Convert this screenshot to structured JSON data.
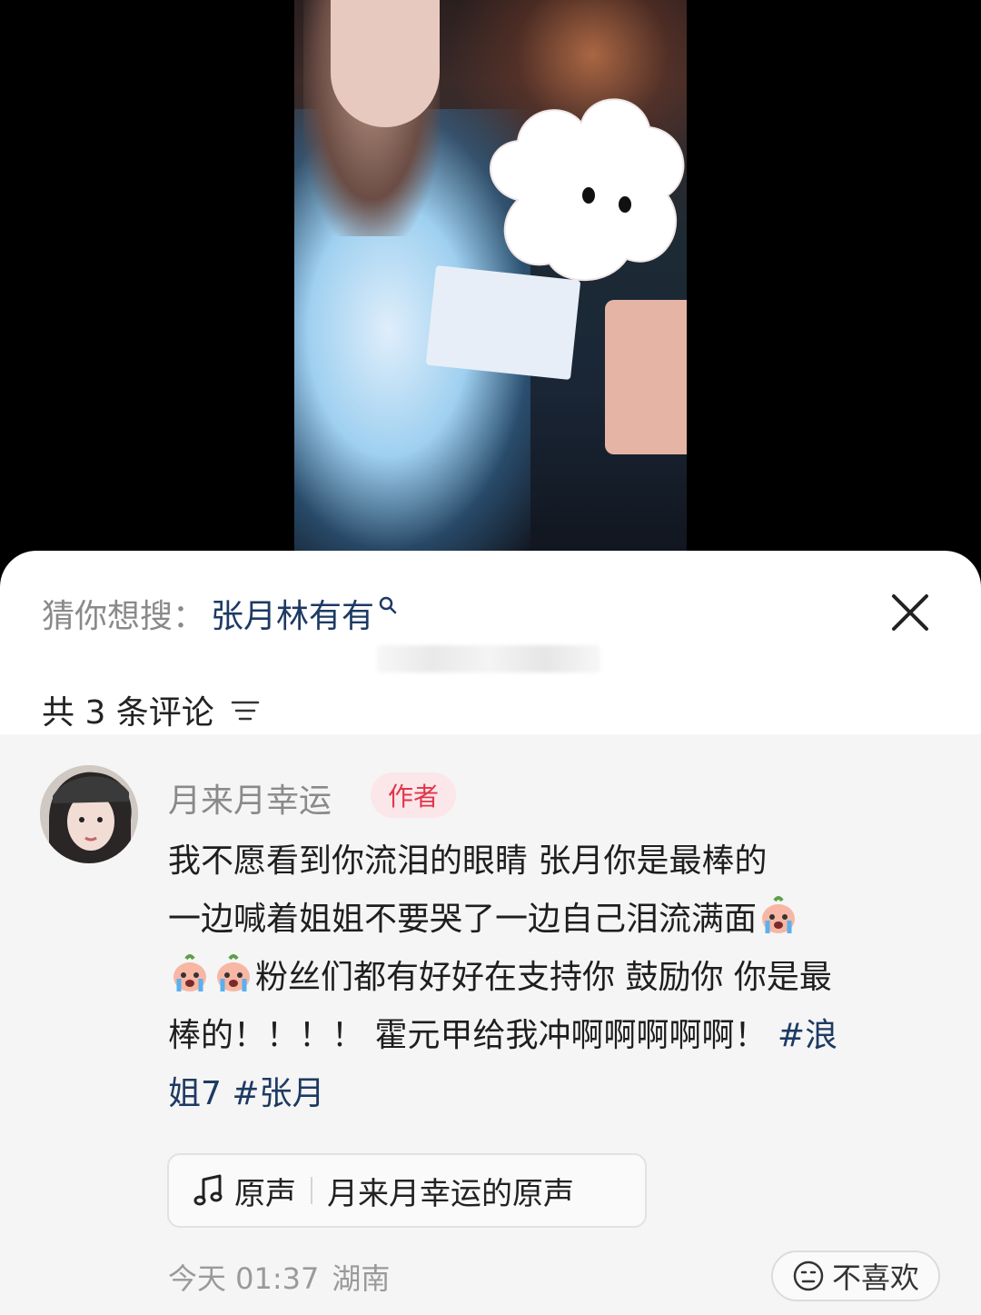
{
  "search_suggestion": {
    "label": "猜你想搜：",
    "query": "张月林有有",
    "icon": "search-icon"
  },
  "close_icon": "close-icon",
  "comments_header": {
    "count_text": "共 3 条评论",
    "sort_icon": "sort-icon"
  },
  "comment": {
    "username": "月来月幸运",
    "badge": "作者",
    "text_1": "我不愿看到你流泪的眼睛 张月你是最棒的",
    "text_2": "一边喊着姐姐不要哭了一边自己泪流满面",
    "text_3": "粉丝们都有好好在支持你 鼓励你 你是最",
    "text_4": "棒的！！！！ 霍元甲给我冲啊啊啊啊啊！",
    "hashtag_1a": "#浪",
    "hashtag_1b": "姐7",
    "hashtag_2": "#张月",
    "emoji": "crying-face-emoji",
    "sound": {
      "label": "原声",
      "title": "月来月幸运的原声",
      "icon": "music-note-icon"
    },
    "time": "今天 01:37",
    "location": "湖南",
    "dislike_label": "不喜欢",
    "dislike_icon": "frown-face-icon"
  },
  "colors": {
    "link": "#1d3a63",
    "badge_text": "#e0364a",
    "badge_bg": "#fbe6e9",
    "secondary_text": "#8a8a8a"
  }
}
